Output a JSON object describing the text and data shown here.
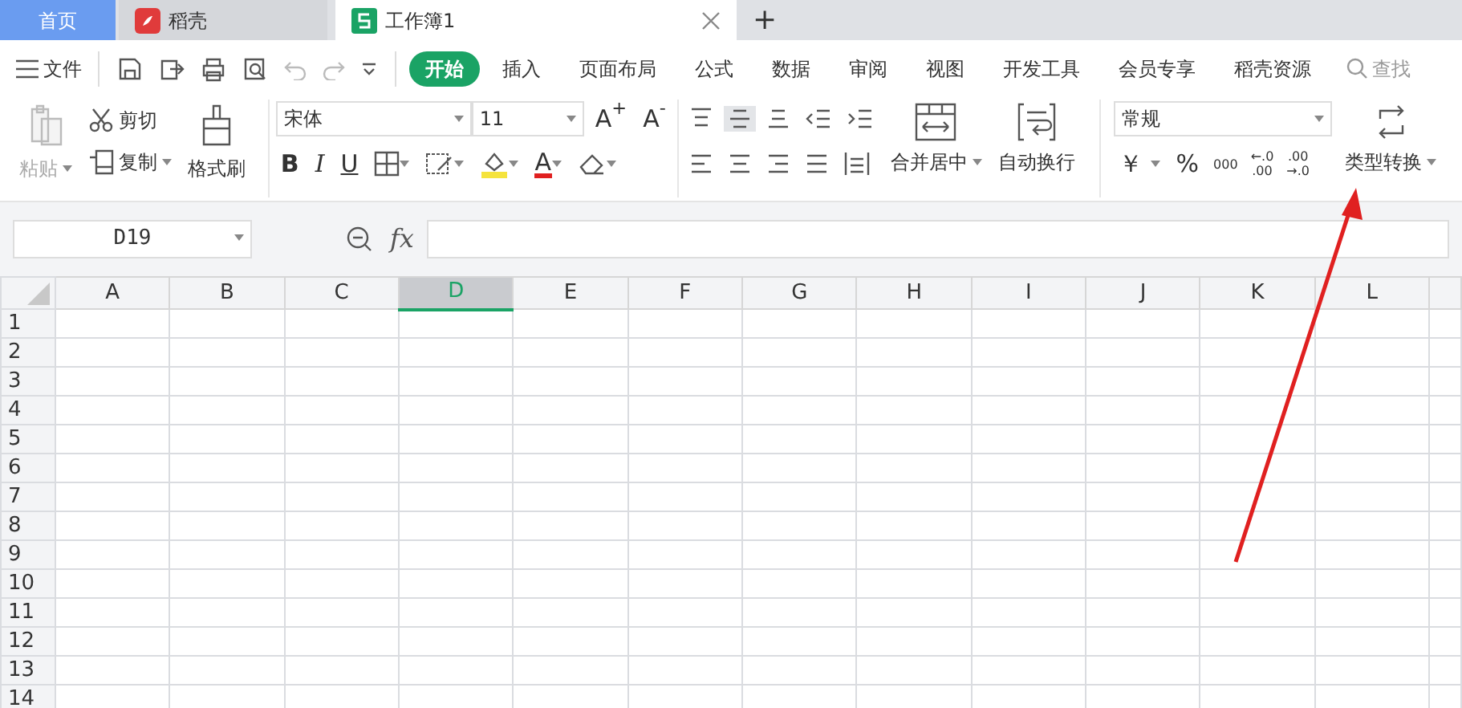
{
  "tabs": [
    {
      "kind": "home",
      "label": "首页",
      "selected": false
    },
    {
      "kind": "docer",
      "label": "稻壳",
      "selected": false
    },
    {
      "kind": "sheet",
      "label": "工作簿1",
      "selected": true
    }
  ],
  "new_tab": "+",
  "menu": {
    "file": "文件",
    "tabs": [
      {
        "label": "开始",
        "selected": true
      },
      {
        "label": "插入",
        "selected": false
      },
      {
        "label": "页面布局",
        "selected": false
      },
      {
        "label": "公式",
        "selected": false
      },
      {
        "label": "数据",
        "selected": false
      },
      {
        "label": "审阅",
        "selected": false
      },
      {
        "label": "视图",
        "selected": false
      },
      {
        "label": "开发工具",
        "selected": false
      },
      {
        "label": "会员专享",
        "selected": false
      },
      {
        "label": "稻壳资源",
        "selected": false
      }
    ],
    "search": "查找"
  },
  "clipboard": {
    "paste": {
      "label": "粘贴",
      "disabled": true
    },
    "cut": "剪切",
    "copy": "复制",
    "format_painter": "格式刷"
  },
  "font": {
    "name": "宋体",
    "size": "11",
    "grow": "A$^{+}$",
    "shrink": "A$^{-}$",
    "bold": "B",
    "italic": "I",
    "underline": "U",
    "font_color": "A"
  },
  "alignment": {
    "merge": "合并居中",
    "wrap": "自动换行"
  },
  "number": {
    "format": "常规",
    "currency": "￥",
    "percent": "%",
    "thousands": "000",
    "increase_decimal": [
      "←.0",
      ".00"
    ],
    "decrease_decimal": [
      ".00",
      "→.0"
    ],
    "convert": "类型转换"
  },
  "formula_bar": {
    "cell": "D19",
    "fx": "fx"
  },
  "sheet": {
    "columns": [
      {
        "label": "A",
        "selected": false
      },
      {
        "label": "B",
        "selected": false
      },
      {
        "label": "C",
        "selected": false
      },
      {
        "label": "D",
        "selected": true
      },
      {
        "label": "E",
        "selected": false
      },
      {
        "label": "F",
        "selected": false
      },
      {
        "label": "G",
        "selected": false
      },
      {
        "label": "H",
        "selected": false
      },
      {
        "label": "I",
        "selected": false
      },
      {
        "label": "J",
        "selected": false
      },
      {
        "label": "K",
        "selected": false
      },
      {
        "label": "L",
        "selected": false
      }
    ],
    "rows": [
      "1",
      "2",
      "3",
      "4",
      "5",
      "6",
      "7",
      "8",
      "9",
      "10",
      "11",
      "12",
      "13",
      "14"
    ]
  }
}
